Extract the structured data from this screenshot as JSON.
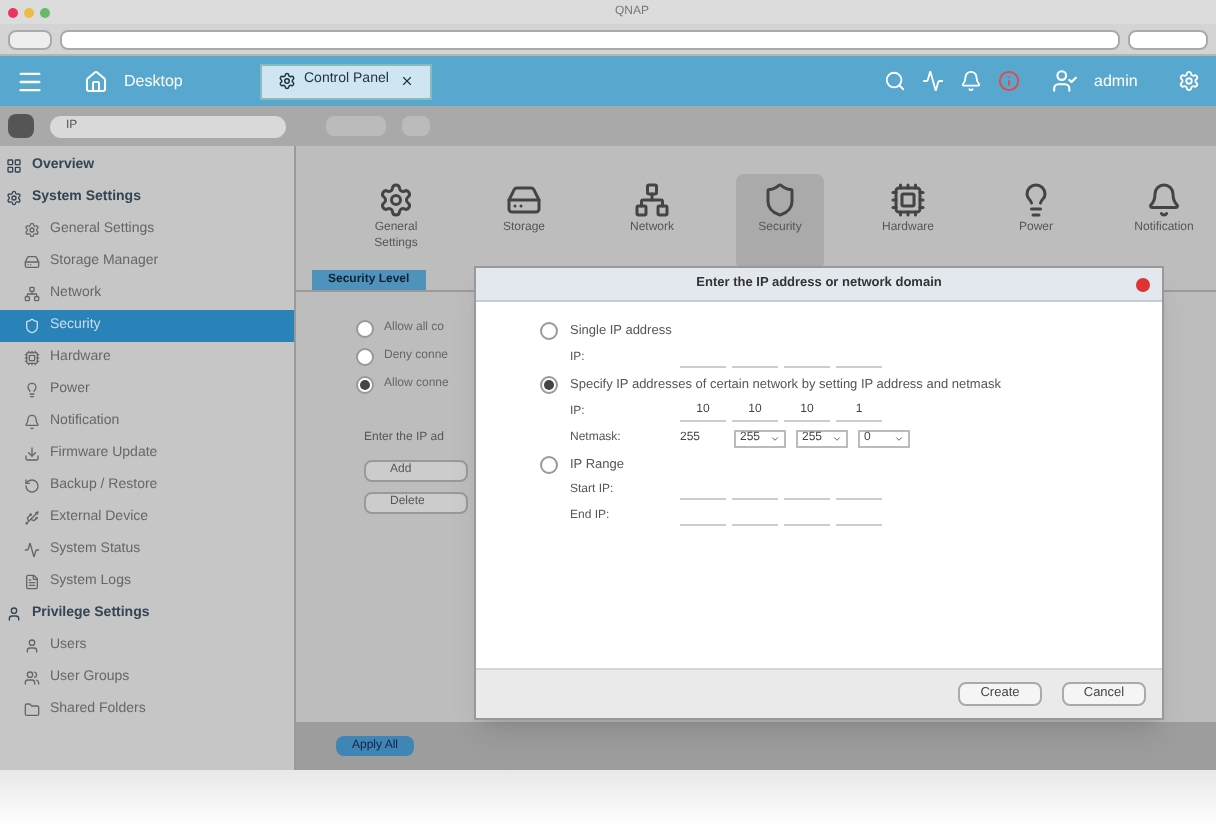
{
  "browser": {
    "title": "QNAP"
  },
  "topbar": {
    "home_label": "Desktop",
    "tabs": [
      {
        "label": "Control Panel",
        "selected": true
      }
    ],
    "user": "admin"
  },
  "toolbar": {
    "search_value": "IP"
  },
  "sidebar": {
    "items": [
      {
        "label": "Overview",
        "kind": "section",
        "selected": false
      },
      {
        "label": "System Settings",
        "kind": "section",
        "selected": false
      },
      {
        "label": "General Settings",
        "kind": "item",
        "selected": false
      },
      {
        "label": "Storage Manager",
        "kind": "item",
        "selected": false
      },
      {
        "label": "Network",
        "kind": "item",
        "selected": false
      },
      {
        "label": "Security",
        "kind": "item",
        "selected": true
      },
      {
        "label": "Hardware",
        "kind": "item",
        "selected": false
      },
      {
        "label": "Power",
        "kind": "item",
        "selected": false
      },
      {
        "label": "Notification",
        "kind": "item",
        "selected": false
      },
      {
        "label": "Firmware Update",
        "kind": "item",
        "selected": false
      },
      {
        "label": "Backup / Restore",
        "kind": "item",
        "selected": false
      },
      {
        "label": "External Device",
        "kind": "item",
        "selected": false
      },
      {
        "label": "System Status",
        "kind": "item",
        "selected": false
      },
      {
        "label": "System Logs",
        "kind": "item",
        "selected": false
      },
      {
        "label": "Privilege Settings",
        "kind": "section",
        "selected": false
      },
      {
        "label": "Users",
        "kind": "item",
        "selected": false
      },
      {
        "label": "User Groups",
        "kind": "item",
        "selected": false
      },
      {
        "label": "Shared Folders",
        "kind": "item",
        "selected": false
      }
    ]
  },
  "categories": [
    {
      "label": "General Settings",
      "selected": false
    },
    {
      "label": "Storage",
      "selected": false
    },
    {
      "label": "Network",
      "selected": false
    },
    {
      "label": "Security",
      "selected": true
    },
    {
      "label": "Hardware",
      "selected": false
    },
    {
      "label": "Power",
      "selected": false
    },
    {
      "label": "Notification",
      "selected": false
    }
  ],
  "subtabs": [
    {
      "label": "Security Level",
      "selected": true
    }
  ],
  "options": [
    {
      "label": "Allow all co",
      "selected": false
    },
    {
      "label": "Deny conne",
      "selected": false
    },
    {
      "label": "Allow conne",
      "selected": true
    }
  ],
  "list_prompt": "Enter the IP ad",
  "list_buttons": [
    "Add",
    "Delete"
  ],
  "apply_button": "Apply All",
  "dialog": {
    "title": "Enter the IP address or network domain",
    "choices": [
      {
        "label": "Single IP address",
        "selected": false,
        "fields": [
          {
            "label": "IP:",
            "kind": "ip"
          }
        ]
      },
      {
        "label": "Specify IP addresses of certain network by setting IP address and netmask",
        "selected": true,
        "fields": [
          {
            "label": "IP:",
            "kind": "ip",
            "parts": [
              "10",
              "10",
              "10",
              "1"
            ]
          },
          {
            "label": "Netmask:",
            "kind": "mask",
            "parts": [
              "255",
              "255",
              "255",
              "0"
            ]
          }
        ]
      },
      {
        "label": "IP Range",
        "selected": false,
        "fields": [
          {
            "label": "Start IP:",
            "kind": "ip"
          },
          {
            "label": "End IP:",
            "kind": "ip"
          }
        ]
      }
    ],
    "buttons": [
      "Create",
      "Cancel"
    ]
  }
}
